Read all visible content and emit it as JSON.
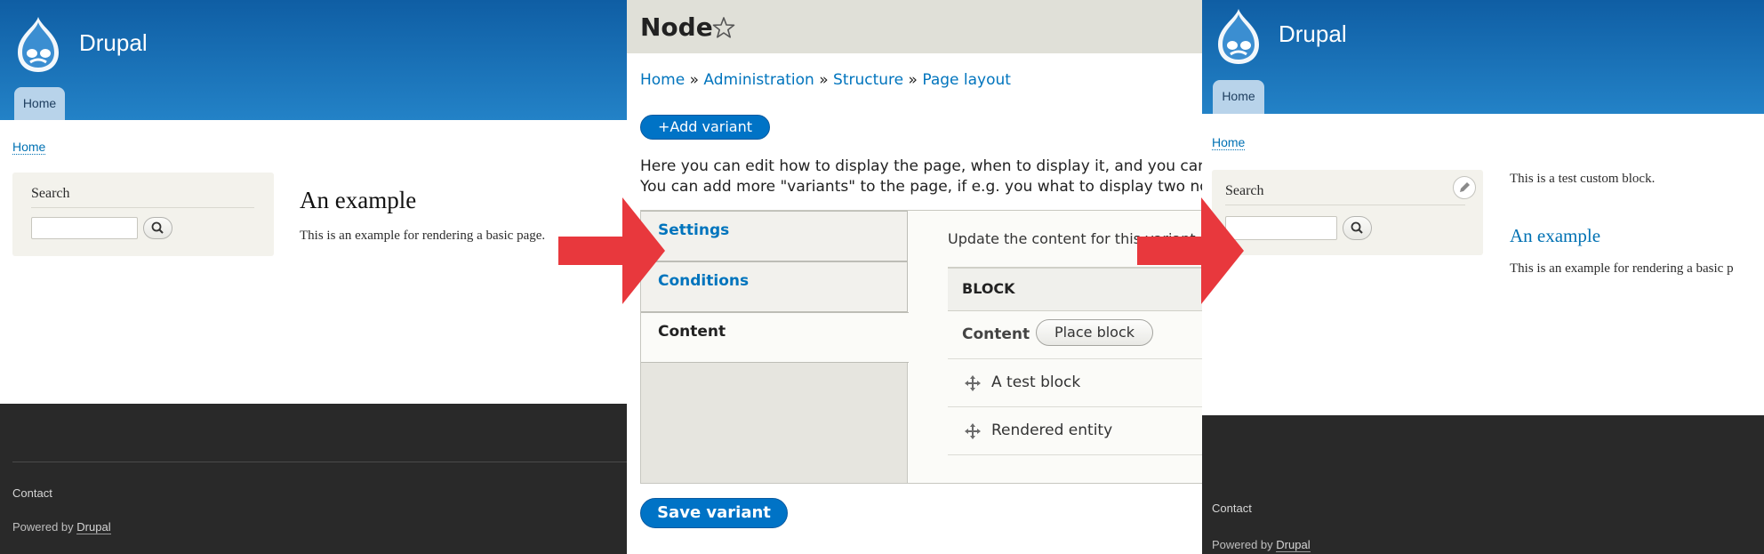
{
  "before": {
    "site_name": "Drupal",
    "tab_home": "Home",
    "breadcrumb_home": "Home",
    "search_title": "Search",
    "page_title": "An example",
    "body_text": "This is an example for rendering a basic page.",
    "footer_contact": "Contact",
    "footer_powered_prefix": "Powered by",
    "footer_powered_link": "Drupal"
  },
  "admin": {
    "title": "Node",
    "breadcrumb": [
      {
        "label": "Home"
      },
      {
        "label": "Administration"
      },
      {
        "label": "Structure"
      },
      {
        "label": "Page layout"
      }
    ],
    "breadcrumb_separator": "»",
    "add_variant_label": "Add variant",
    "description_line1": "Here you can edit how to display the page, when to display it, and you can add",
    "description_line2": "You can add more \"variants\" to the page, if e.g. you what to display two node ty",
    "tabs": [
      {
        "label": "Settings"
      },
      {
        "label": "Conditions"
      },
      {
        "label": "Content"
      }
    ],
    "pane_intro": "Update the content for this variant",
    "table_header": "BLOCK",
    "region_label": "Content",
    "place_block_label": "Place block",
    "blocks": [
      {
        "label": "A test block"
      },
      {
        "label": "Rendered entity"
      }
    ],
    "save_variant_label": "Save variant"
  },
  "after": {
    "site_name": "Drupal",
    "tab_home": "Home",
    "breadcrumb_home": "Home",
    "search_title": "Search",
    "custom_block_text": "This is a test custom block.",
    "page_title": "An example",
    "body_text": "This is an example for rendering a basic p",
    "footer_contact": "Contact",
    "footer_powered_prefix": "Powered by",
    "footer_powered_link": "Drupal"
  },
  "colors": {
    "header_blue": "#1a72b8",
    "link_blue": "#0074bd",
    "arrow_red": "#e8383d",
    "footer_dark": "#292929"
  }
}
